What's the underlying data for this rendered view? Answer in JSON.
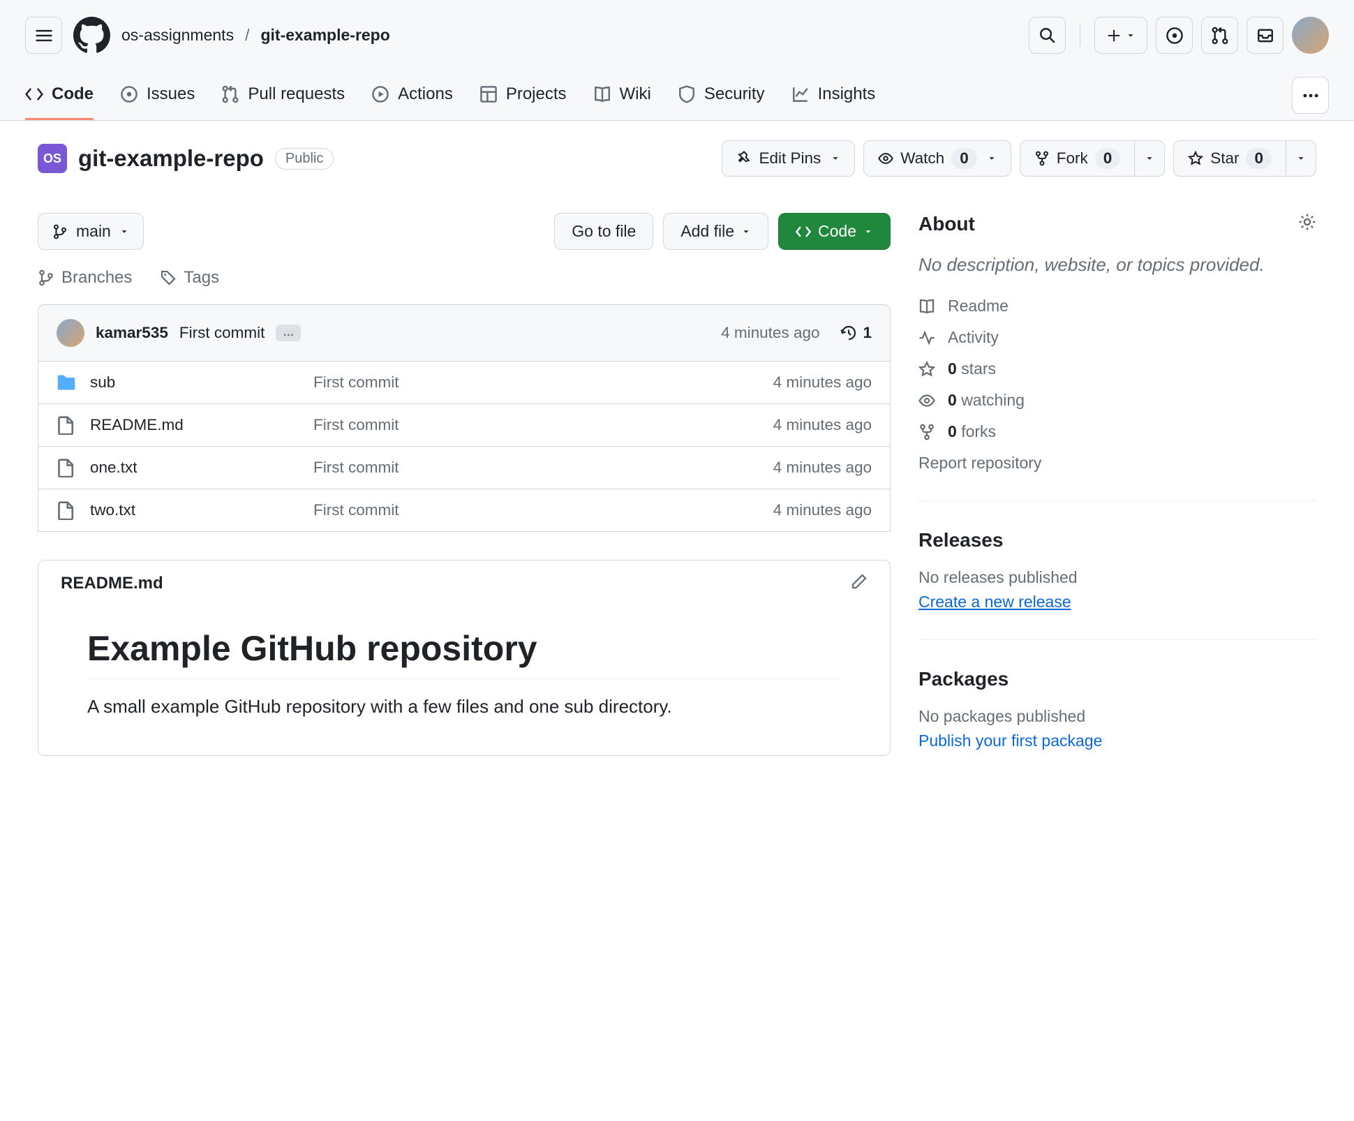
{
  "breadcrumb": {
    "org": "os-assignments",
    "sep": "/",
    "repo": "git-example-repo"
  },
  "nav": {
    "code": "Code",
    "issues": "Issues",
    "pulls": "Pull requests",
    "actions": "Actions",
    "projects": "Projects",
    "wiki": "Wiki",
    "security": "Security",
    "insights": "Insights"
  },
  "repo": {
    "icon_text": "OS",
    "name": "git-example-repo",
    "badge": "Public"
  },
  "actions": {
    "edit_pins": "Edit Pins",
    "watch": "Watch",
    "watch_count": "0",
    "fork": "Fork",
    "fork_count": "0",
    "star": "Star",
    "star_count": "0"
  },
  "file_nav": {
    "branch": "main",
    "go_to_file": "Go to file",
    "add_file": "Add file",
    "code": "Code",
    "branches": "Branches",
    "tags": "Tags"
  },
  "commit": {
    "author": "kamar535",
    "message": "First commit",
    "time": "4 minutes ago",
    "count": "1"
  },
  "files": [
    {
      "type": "dir",
      "name": "sub",
      "msg": "First commit",
      "time": "4 minutes ago"
    },
    {
      "type": "file",
      "name": "README.md",
      "msg": "First commit",
      "time": "4 minutes ago"
    },
    {
      "type": "file",
      "name": "one.txt",
      "msg": "First commit",
      "time": "4 minutes ago"
    },
    {
      "type": "file",
      "name": "two.txt",
      "msg": "First commit",
      "time": "4 minutes ago"
    }
  ],
  "readme": {
    "filename": "README.md",
    "title": "Example GitHub repository",
    "body": "A small example GitHub repository with a few files and one sub directory."
  },
  "sidebar": {
    "about": {
      "title": "About",
      "desc": "No description, website, or topics provided.",
      "readme": "Readme",
      "activity": "Activity",
      "stars_n": "0",
      "stars_t": "stars",
      "watching_n": "0",
      "watching_t": "watching",
      "forks_n": "0",
      "forks_t": "forks",
      "report": "Report repository"
    },
    "releases": {
      "title": "Releases",
      "none": "No releases published",
      "create": "Create a new release"
    },
    "packages": {
      "title": "Packages",
      "none": "No packages published",
      "publish": "Publish your first package"
    }
  }
}
